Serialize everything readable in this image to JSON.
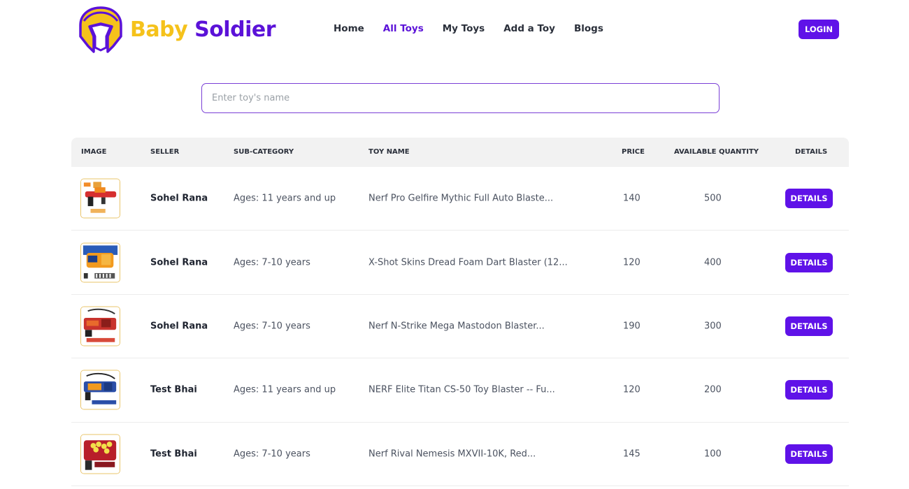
{
  "brand": {
    "part1": "Baby",
    "part2": "Soldier",
    "logo_icon": "spartan-helmet-icon"
  },
  "nav": [
    {
      "label": "Home",
      "active": false
    },
    {
      "label": "All Toys",
      "active": true
    },
    {
      "label": "My Toys",
      "active": false
    },
    {
      "label": "Add a Toy",
      "active": false
    },
    {
      "label": "Blogs",
      "active": false
    }
  ],
  "login_label": "LOGIN",
  "search": {
    "placeholder": "Enter toy's name",
    "value": ""
  },
  "table": {
    "headers": {
      "image": "IMAGE",
      "seller": "SELLER",
      "subcategory": "SUB-CATEGORY",
      "toy_name": "TOY NAME",
      "price": "PRICE",
      "quantity": "AVAILABLE QUANTITY",
      "details": "DETAILS"
    },
    "rows": [
      {
        "seller": "Sohel Rana",
        "subcategory": "Ages: 11 years and up",
        "toy_name": "Nerf Pro Gelfire Mythic Full Auto Blaste...",
        "price": "140",
        "quantity": "500",
        "details_label": "DETAILS"
      },
      {
        "seller": "Sohel Rana",
        "subcategory": "Ages: 7-10 years",
        "toy_name": "X-Shot Skins Dread Foam Dart Blaster (12...",
        "price": "120",
        "quantity": "400",
        "details_label": "DETAILS"
      },
      {
        "seller": "Sohel Rana",
        "subcategory": "Ages: 7-10 years",
        "toy_name": "Nerf N-Strike Mega Mastodon Blaster...",
        "price": "190",
        "quantity": "300",
        "details_label": "DETAILS"
      },
      {
        "seller": "Test Bhai",
        "subcategory": "Ages: 11 years and up",
        "toy_name": "NERF Elite Titan CS-50 Toy Blaster -- Fu...",
        "price": "120",
        "quantity": "200",
        "details_label": "DETAILS"
      },
      {
        "seller": "Test Bhai",
        "subcategory": "Ages: 7-10 years",
        "toy_name": "Nerf Rival Nemesis MXVII-10K, Red...",
        "price": "145",
        "quantity": "100",
        "details_label": "DETAILS"
      }
    ]
  },
  "colors": {
    "accent": "#5f12e8",
    "brand_yellow": "#f5c21b",
    "brand_purple": "#5b12d8"
  }
}
